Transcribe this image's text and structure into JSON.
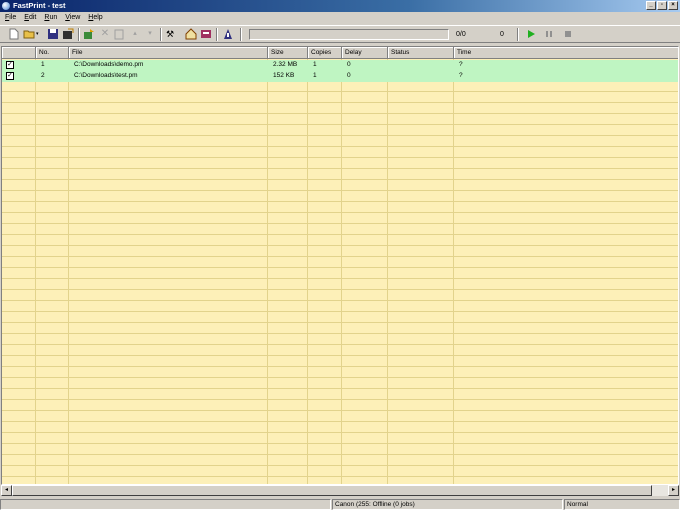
{
  "window": {
    "title": "FastPrint - test"
  },
  "menu": [
    "File",
    "Edit",
    "Run",
    "View",
    "Help"
  ],
  "toolbar": {
    "progress_count": "0/0",
    "counter": "0"
  },
  "table": {
    "columns": [
      "",
      "No.",
      "File",
      "Size",
      "Copies",
      "Delay",
      "Status",
      "Time"
    ],
    "rows": [
      {
        "checked": true,
        "no": "1",
        "file": "C:\\Downloads\\demo.pm",
        "size": "2.32 MB",
        "copies": "1",
        "delay": "0",
        "status": "",
        "time": "?"
      },
      {
        "checked": true,
        "no": "2",
        "file": "C:\\Downloads\\test.pm",
        "size": "152 KB",
        "copies": "1",
        "delay": "0",
        "status": "",
        "time": "?"
      }
    ]
  },
  "statusbar": {
    "printer": "Canon (255: Offline (0 jobs)",
    "mode": "Normal"
  },
  "colors": {
    "list_bg": "#fdf0b8",
    "row_highlight": "#bff5c2",
    "title_start": "#0a246a"
  }
}
